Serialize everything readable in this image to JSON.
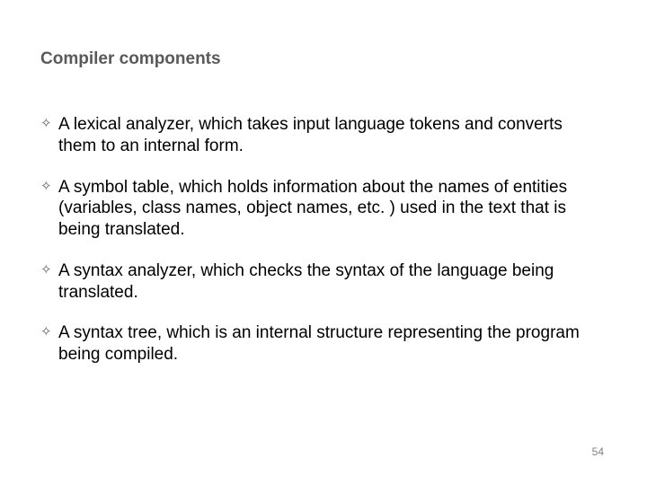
{
  "title": "Compiler components",
  "bullets": [
    "A lexical analyzer, which takes input language tokens and converts them to an internal form.",
    "A symbol table, which holds information about the names of entities (variables, class names, object names, etc. ) used in the text that is being translated.",
    "A syntax analyzer, which checks the syntax of the language being translated.",
    "A syntax tree, which is an internal structure representing the program being compiled."
  ],
  "page_number": "54"
}
